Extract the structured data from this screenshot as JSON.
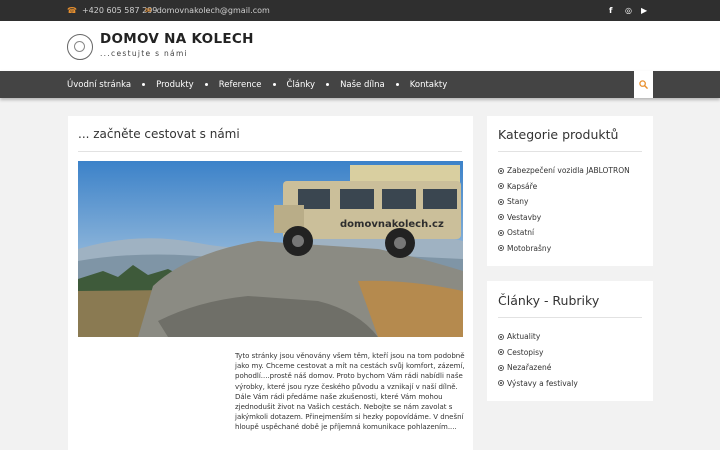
{
  "topbar": {
    "phone": "+420 605 587 299",
    "email": "domovnakolech@gmail.com",
    "phone_icon": "phone-icon",
    "email_icon": "envelope-icon",
    "social": [
      {
        "icon": "facebook-icon",
        "glyph": "f"
      },
      {
        "icon": "instagram-icon",
        "glyph": "◎"
      },
      {
        "icon": "youtube-icon",
        "glyph": "▶"
      }
    ]
  },
  "header": {
    "title": "DOMOV NA KOLECH",
    "tagline": "...cestujte s námi"
  },
  "nav": {
    "items": [
      "Úvodní stránka",
      "Produkty",
      "Reference",
      "Články",
      "Naše dílna",
      "Kontakty"
    ],
    "search_icon": "search-icon"
  },
  "main": {
    "title": "... začněte cestovat s námi",
    "photo_text": "domovnakolech.cz",
    "text": "Tyto stránky jsou věnovány všem těm, kteří jsou na tom podobně jako my.  Chceme cestovat a mít na cestách svůj komfort, zázemí, pohodlí....prostě náš domov. Proto bychom Vám rádi nabídli naše výrobky, které jsou ryze českého původu a vznikají v naší dílně. Dále Vám rádi předáme naše zkušenosti, které Vám mohou zjednodušit život na Vašich cestách.  Nebojte se nám zavolat s jakýmkoli dotazem. Přinejmenším si hezky popovídáme. V dnešní hloupě uspěchané době je příjemná komunikace pohlazením...."
  },
  "sidebar": {
    "categories": {
      "title": "Kategorie produktů",
      "items": [
        "Zabezpečení vozidla JABLOTRON",
        "Kapsáře",
        "Stany",
        "Vestavby",
        "Ostatní",
        "Motobrašny"
      ]
    },
    "articles": {
      "title": "Články - Rubriky",
      "items": [
        "Aktuality",
        "Cestopisy",
        "Nezařazené",
        "Výstavy a festivaly"
      ]
    }
  },
  "colors": {
    "topbar_bg": "#2f2f2f",
    "nav_bg": "#444444",
    "accent": "#e8902f",
    "page_bg": "#f2f2f2"
  }
}
